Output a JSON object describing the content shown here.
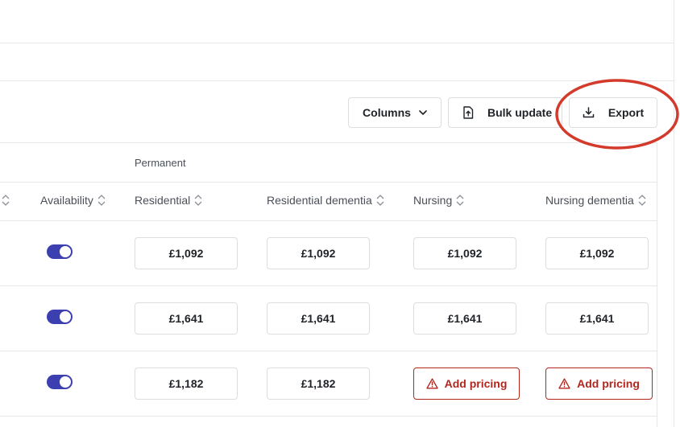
{
  "toolbar": {
    "columns_label": "Columns",
    "bulk_update_label": "Bulk update",
    "export_label": "Export"
  },
  "table": {
    "group_header": "Permanent",
    "columns": {
      "availability": "Availability",
      "residential": "Residential",
      "residential_dementia": "Residential dementia",
      "nursing": "Nursing",
      "nursing_dementia": "Nursing dementia"
    },
    "rows": [
      {
        "available": true,
        "residential": "£1,092",
        "residential_dementia": "£1,092",
        "nursing": "£1,092",
        "nursing_dementia": "£1,092"
      },
      {
        "available": true,
        "residential": "£1,641",
        "residential_dementia": "£1,641",
        "nursing": "£1,641",
        "nursing_dementia": "£1,641"
      },
      {
        "available": true,
        "residential": "£1,182",
        "residential_dementia": "£1,182",
        "nursing": "Add pricing",
        "nursing_dementia": "Add pricing"
      }
    ]
  },
  "colors": {
    "toggle_on": "#3b3fb0",
    "warning_red": "#b3261e",
    "annotation_red": "#d43a2b"
  }
}
